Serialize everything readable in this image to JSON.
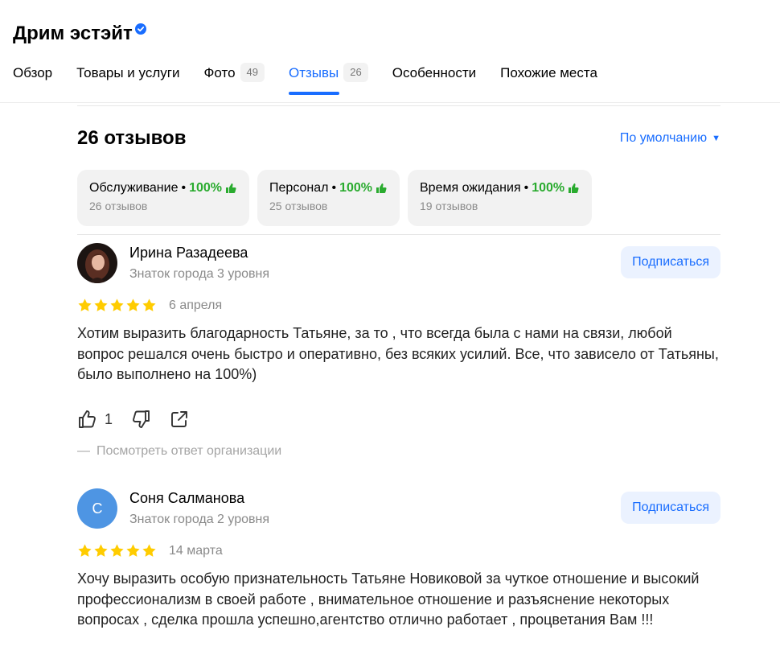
{
  "org": {
    "title": "Дрим эстэйт",
    "verified_icon": "verified-check-icon"
  },
  "tabs": [
    {
      "label": "Обзор",
      "count": null
    },
    {
      "label": "Товары и услуги",
      "count": null
    },
    {
      "label": "Фото",
      "count": "49"
    },
    {
      "label": "Отзывы",
      "count": "26",
      "active": true
    },
    {
      "label": "Особенности",
      "count": null
    },
    {
      "label": "Похожие места",
      "count": null
    }
  ],
  "reviews_header": {
    "count_text": "26 отзывов",
    "sort_label": "По умолчанию",
    "sort_icon": "caret-down-icon"
  },
  "aspects": [
    {
      "name": "Обслуживание",
      "percent": "100%",
      "reviews": "26 отзывов"
    },
    {
      "name": "Персонал",
      "percent": "100%",
      "reviews": "25 отзывов"
    },
    {
      "name": "Время ожидания",
      "percent": "100%",
      "reviews": "19 отзывов"
    }
  ],
  "reviews": [
    {
      "author": "Ирина Разадеева",
      "level": "Знаток города 3 уровня",
      "avatar_type": "photo",
      "subscribe_label": "Подписаться",
      "rating": 5,
      "date": "6 апреля",
      "text": "Хотим выразить благодарность Татьяне, за то , что всегда была с нами на связи, любой вопрос решался очень быстро и оперативно, без всяких усилий. Все, что зависело от Татьяны, было выполнено на 100%)",
      "likes": "1",
      "org_answer_label": "Посмотреть ответ организации"
    },
    {
      "author": "Соня Салманова",
      "level": "Знаток города 2 уровня",
      "avatar_type": "letter",
      "avatar_letter": "С",
      "subscribe_label": "Подписаться",
      "rating": 5,
      "date": "14 марта",
      "text": "Хочу выразить особую признательность Татьяне Новиковой за чуткое отношение и высокий профессионализм в своей работе , внимательное отношение и разъяснение некоторых вопросах , сделка прошла успешно,агентство отлично работает , процветания Вам !!!"
    }
  ],
  "colors": {
    "accent": "#196dff",
    "positive": "#2aab2f",
    "star": "#fc0",
    "muted": "#8a8a8a"
  }
}
